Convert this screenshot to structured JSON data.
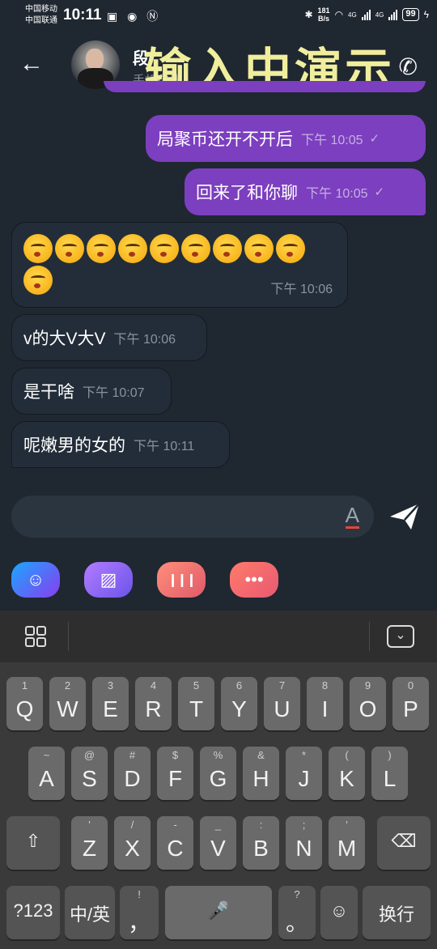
{
  "status_bar": {
    "carrier1": "中国移动",
    "carrier2": "中国联通",
    "time": "10:11",
    "left_icons": "▣ ◉ Ⓝ",
    "net_speed_value": "181",
    "net_speed_unit": "B/s",
    "net1": "4G",
    "net2": "4G",
    "battery": "99"
  },
  "header": {
    "back_icon": "arrow-left",
    "contact_name": "段",
    "contact_status": "手机在线",
    "overlay_text": "输入中演示",
    "phone_icon": "phone"
  },
  "messages": [
    {
      "dir": "out",
      "text": "局聚币还开不开后",
      "time": "下午 10:05",
      "status": "✓"
    },
    {
      "dir": "out",
      "text": "回来了和你聊",
      "time": "下午 10:05",
      "status": "✓"
    },
    {
      "dir": "in",
      "emoji_count": 10,
      "time": "下午 10:06"
    },
    {
      "dir": "in",
      "text": "v的大V大V",
      "time": "下午 10:06"
    },
    {
      "dir": "in",
      "text": "是干啥",
      "time": "下午 10:07"
    },
    {
      "dir": "in",
      "text": "呢嫩男的女的",
      "time": "下午 10:11"
    }
  ],
  "composer": {
    "input_value": "",
    "font_icon": "A",
    "send_icon": "send",
    "tools": [
      {
        "name": "emoji",
        "glyph": "☺",
        "color": "#2a8ff0"
      },
      {
        "name": "gallery",
        "glyph": "▨",
        "color": "#8b6cf0"
      },
      {
        "name": "voice",
        "glyph": "❙❙❙",
        "color": "#f27b6a"
      },
      {
        "name": "more",
        "glyph": "•••",
        "color": "#f06a6a"
      }
    ]
  },
  "keyboard": {
    "row1": [
      {
        "sub": "1",
        "main": "Q"
      },
      {
        "sub": "2",
        "main": "W"
      },
      {
        "sub": "3",
        "main": "E"
      },
      {
        "sub": "4",
        "main": "R"
      },
      {
        "sub": "5",
        "main": "T"
      },
      {
        "sub": "6",
        "main": "Y"
      },
      {
        "sub": "7",
        "main": "U"
      },
      {
        "sub": "8",
        "main": "I"
      },
      {
        "sub": "9",
        "main": "O"
      },
      {
        "sub": "0",
        "main": "P"
      }
    ],
    "row2": [
      {
        "sub": "~",
        "main": "A"
      },
      {
        "sub": "@",
        "main": "S"
      },
      {
        "sub": "#",
        "main": "D"
      },
      {
        "sub": "$",
        "main": "F"
      },
      {
        "sub": "%",
        "main": "G"
      },
      {
        "sub": "&",
        "main": "H"
      },
      {
        "sub": "*",
        "main": "J"
      },
      {
        "sub": "(",
        "main": "K"
      },
      {
        "sub": ")",
        "main": "L"
      }
    ],
    "row3": [
      {
        "sub": "'",
        "main": "Z"
      },
      {
        "sub": "/",
        "main": "X"
      },
      {
        "sub": "-",
        "main": "C"
      },
      {
        "sub": "_",
        "main": "V"
      },
      {
        "sub": ":",
        "main": "B"
      },
      {
        "sub": ";",
        "main": "N"
      },
      {
        "sub": "'",
        "main": "M"
      }
    ],
    "shift": "⇧",
    "backspace": "⌫",
    "num": "?123",
    "lang": "中/英",
    "comma": "，",
    "comma_sub": "!",
    "space": "🎤",
    "period": "。",
    "period_sub": "?",
    "emoji": "☺",
    "enter": "换行"
  }
}
